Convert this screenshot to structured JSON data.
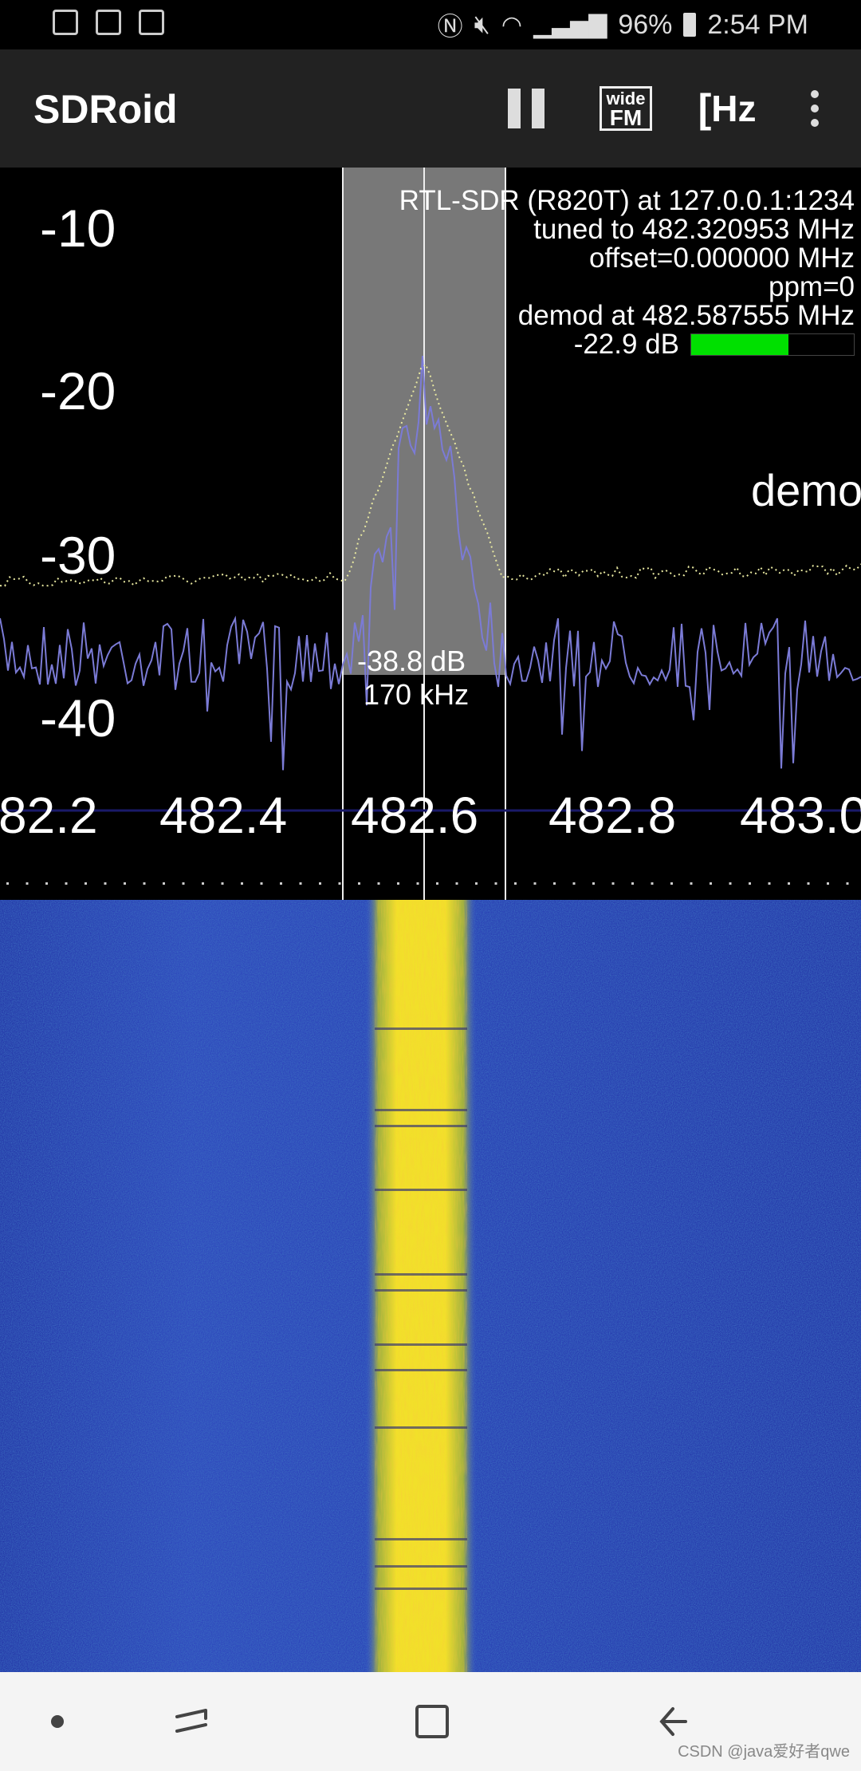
{
  "status_bar": {
    "battery": "96%",
    "time": "2:54 PM"
  },
  "app_bar": {
    "title": "SDRoid",
    "mode_top": "wide",
    "mode_bottom": "FM",
    "unit_label": "Hz"
  },
  "spectrum": {
    "y_labels": [
      "-10",
      "-20",
      "-30",
      "-40"
    ],
    "x_labels": [
      "82.2",
      "482.4",
      "482.6",
      "482.8",
      "483.0"
    ],
    "info_lines": [
      "RTL-SDR (R820T) at 127.0.0.1:1234",
      "tuned to 482.320953 MHz",
      "offset=0.000000 MHz",
      "ppm=0"
    ],
    "demod_line": "demod at 482.587555 MHz",
    "level": "-22.9 dB",
    "level_fraction": 0.6,
    "marker_level": "-38.8 dB",
    "bandwidth": "170 kHz",
    "demod_overlay": "demod"
  },
  "watermark": "CSDN @java爱好者qwe",
  "colors": {
    "background": "#000000",
    "appbar": "#222222",
    "trace": "#7b7bd6",
    "level_bar": "#00e000",
    "waterfall_bg": "#2a3fb0",
    "waterfall_signal": "#f2e02a"
  }
}
